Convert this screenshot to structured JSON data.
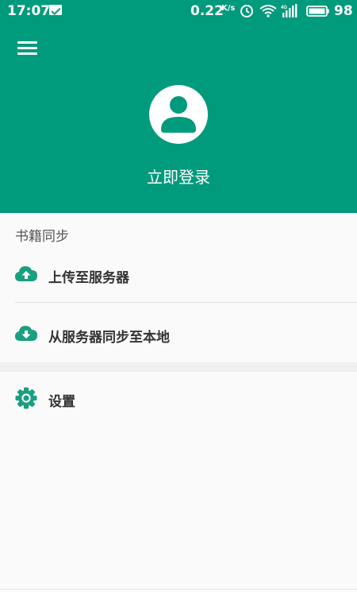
{
  "status_bar": {
    "time": "17:07",
    "net_speed": "0.22",
    "net_unit": "K/s",
    "network_type": "4G",
    "battery": "98",
    "icons": [
      "mail-icon",
      "alarm-icon",
      "wifi-icon",
      "signal-icon",
      "battery-icon"
    ]
  },
  "header": {
    "background": "#009a7c",
    "login_label": "立即登录"
  },
  "sync_section": {
    "title": "书籍同步",
    "items": [
      {
        "label": "上传至服务器",
        "icon": "cloud-upload-icon"
      },
      {
        "label": "从服务器同步至本地",
        "icon": "cloud-download-icon"
      }
    ]
  },
  "settings": {
    "label": "设置",
    "icon": "gear-icon"
  },
  "colors": {
    "accent": "#009a7c",
    "background": "#fafafa",
    "text": "#333333"
  }
}
